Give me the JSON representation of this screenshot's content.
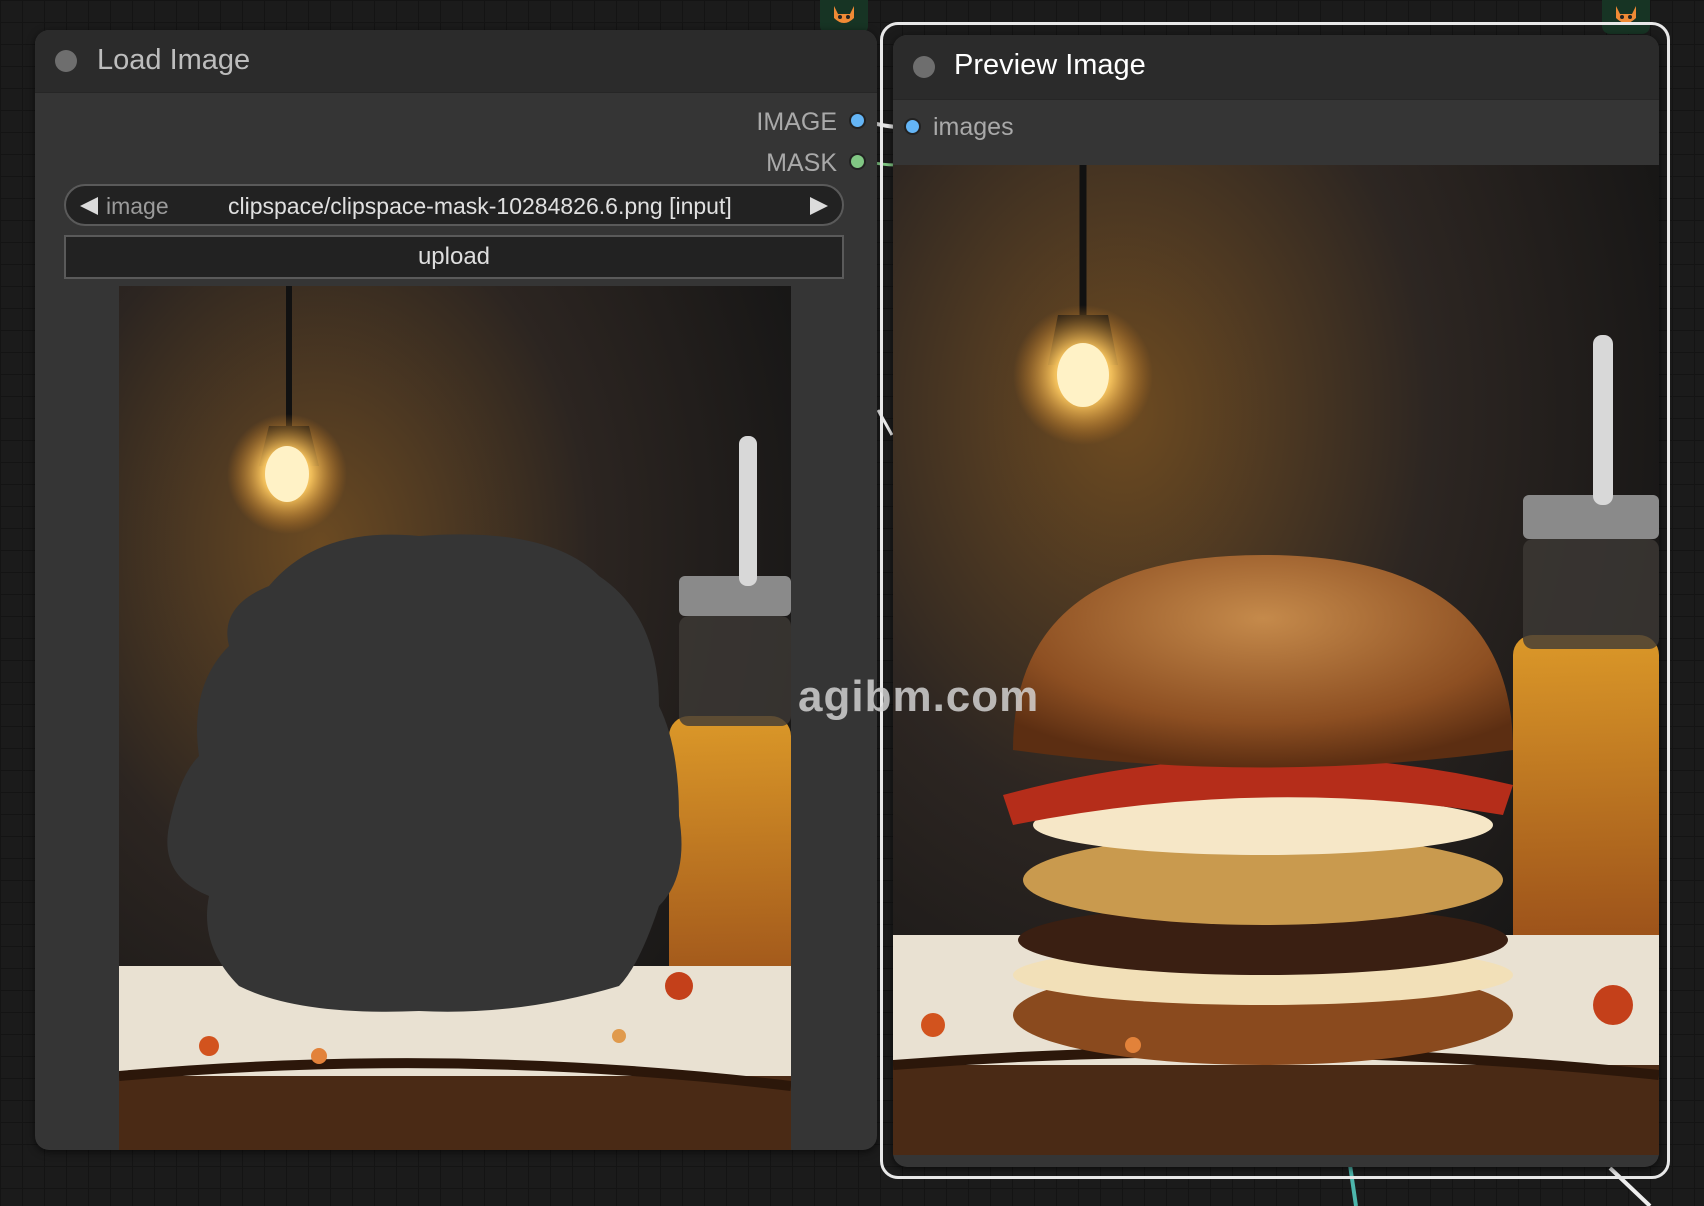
{
  "load_node": {
    "title": "Load Image",
    "outputs": [
      {
        "label": "IMAGE",
        "color": "#64b5f6"
      },
      {
        "label": "MASK",
        "color": "#81c784"
      }
    ],
    "image_widget": {
      "name": "image",
      "value": "clipspace/clipspace-mask-10284826.6.png [input]"
    },
    "upload_label": "upload"
  },
  "preview_node": {
    "title": "Preview Image",
    "inputs": [
      {
        "label": "images",
        "color": "#64b5f6"
      }
    ]
  },
  "watermark": "agibm.com",
  "icons": [
    "fox-badge-icon",
    "arrow-left-icon",
    "arrow-right-icon",
    "status-dot-icon"
  ]
}
